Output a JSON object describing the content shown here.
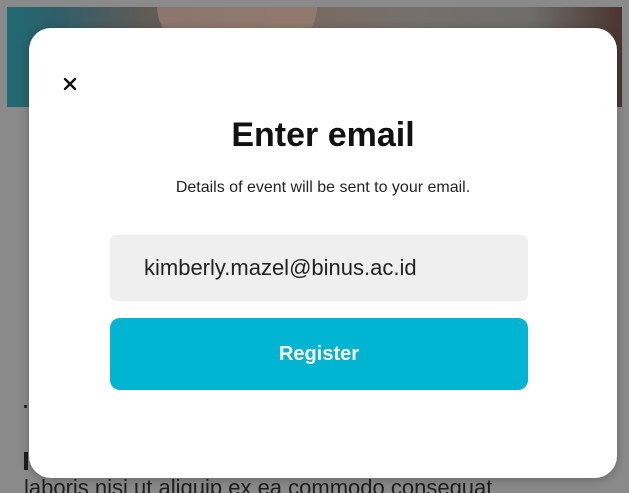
{
  "background": {
    "paragraph_fragment": "laboris nisi ut aliquip ex ea commodo consequat"
  },
  "modal": {
    "close_icon": "close-icon",
    "title": "Enter email",
    "subtitle": "Details of event will be sent to your email.",
    "email_value": "kimberly.mazel@binus.ac.id",
    "register_label": "Register"
  },
  "colors": {
    "accent": "#00b4d2",
    "input_bg": "#efefef",
    "overlay": "#8a8a8a"
  }
}
